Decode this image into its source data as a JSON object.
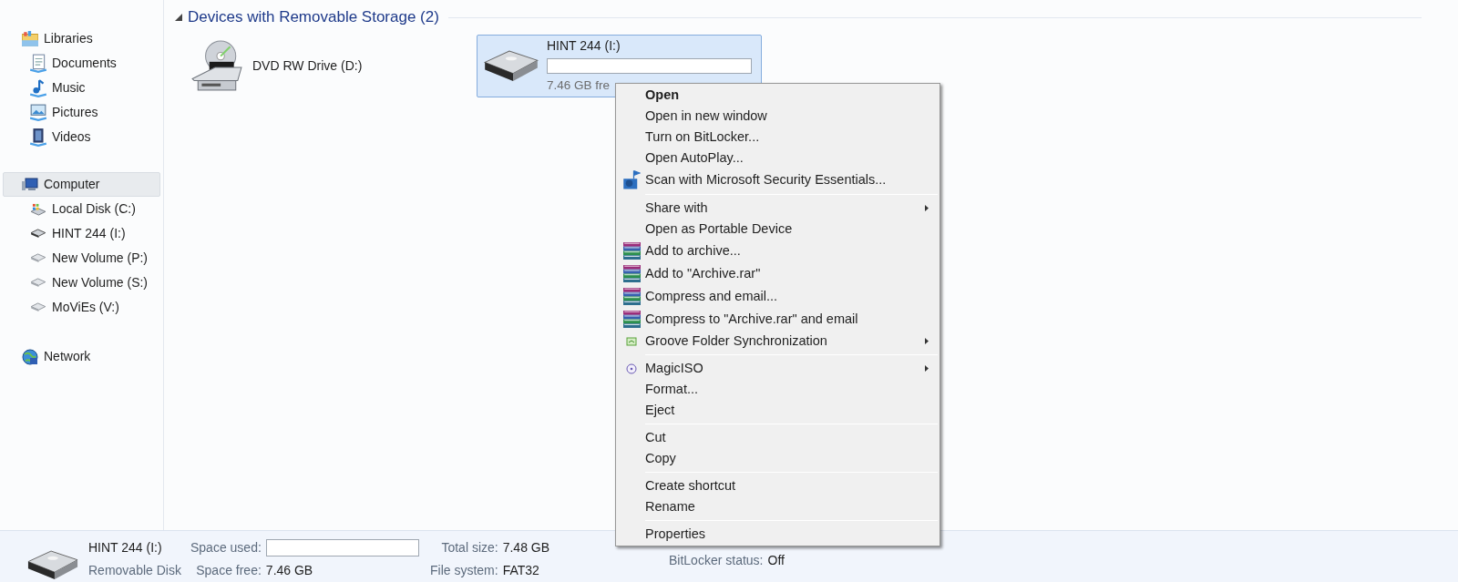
{
  "sidebar": {
    "groups": [
      {
        "label": "Libraries",
        "kind": "libraries",
        "selected": false,
        "children": [
          {
            "label": "Documents",
            "kind": "documents"
          },
          {
            "label": "Music",
            "kind": "music"
          },
          {
            "label": "Pictures",
            "kind": "pictures"
          },
          {
            "label": "Videos",
            "kind": "videos"
          }
        ]
      },
      {
        "label": "Computer",
        "kind": "computer",
        "selected": true,
        "children": [
          {
            "label": "Local Disk (C:)",
            "kind": "system"
          },
          {
            "label": "HINT 244 (I:)",
            "kind": "removable"
          },
          {
            "label": "New Volume (P:)",
            "kind": "disk"
          },
          {
            "label": "New Volume (S:)",
            "kind": "disk"
          },
          {
            "label": "MoViEs (V:)",
            "kind": "disk"
          }
        ]
      },
      {
        "label": "Network",
        "kind": "network",
        "selected": false
      }
    ]
  },
  "section": {
    "title": "Devices with Removable Storage (2)",
    "expanded": true,
    "devices": [
      {
        "name": "DVD RW Drive (D:)",
        "kind": "dvd",
        "selected": false
      },
      {
        "name": "HINT 244 (I:)",
        "kind": "removable",
        "selected": true,
        "free": "7.46 GB fre"
      }
    ]
  },
  "context_menu": {
    "items": [
      {
        "kind": "plain",
        "label": "Open",
        "default": true
      },
      {
        "kind": "plain",
        "label": "Open in new window"
      },
      {
        "kind": "plain",
        "label": "Turn on BitLocker..."
      },
      {
        "kind": "plain",
        "label": "Open AutoPlay..."
      },
      {
        "kind": "shield",
        "label": "Scan with Microsoft Security Essentials..."
      },
      {
        "kind": "separator"
      },
      {
        "kind": "plain",
        "label": "Share with",
        "submenu": true
      },
      {
        "kind": "plain",
        "label": "Open as Portable Device"
      },
      {
        "kind": "archive",
        "label": "Add to archive..."
      },
      {
        "kind": "archive",
        "label": "Add to \"Archive.rar\""
      },
      {
        "kind": "archive",
        "label": "Compress and email..."
      },
      {
        "kind": "archive",
        "label": "Compress to \"Archive.rar\" and email"
      },
      {
        "kind": "sync",
        "label": "Groove Folder Synchronization",
        "submenu": true
      },
      {
        "kind": "separator"
      },
      {
        "kind": "disc",
        "label": "MagicISO",
        "submenu": true
      },
      {
        "kind": "plain",
        "label": "Format..."
      },
      {
        "kind": "plain",
        "label": "Eject"
      },
      {
        "kind": "separator"
      },
      {
        "kind": "plain",
        "label": "Cut"
      },
      {
        "kind": "plain",
        "label": "Copy"
      },
      {
        "kind": "separator"
      },
      {
        "kind": "plain",
        "label": "Create shortcut"
      },
      {
        "kind": "plain",
        "label": "Rename"
      },
      {
        "kind": "separator"
      },
      {
        "kind": "plain",
        "label": "Properties"
      }
    ]
  },
  "status_bar": {
    "name": "HINT 244 (I:)",
    "type": "Removable Disk",
    "columns": [
      [
        {
          "label": "Space used:",
          "kind": "bar"
        },
        {
          "label": "Space free:",
          "kind": "text",
          "value": "7.46 GB"
        }
      ],
      [
        {
          "label": "Total size:",
          "kind": "text",
          "value": "7.48 GB"
        },
        {
          "label": "File system:",
          "kind": "text",
          "value": "FAT32"
        }
      ],
      [
        {
          "label": "BitLocker status:",
          "kind": "text",
          "value": "Off"
        }
      ]
    ]
  }
}
